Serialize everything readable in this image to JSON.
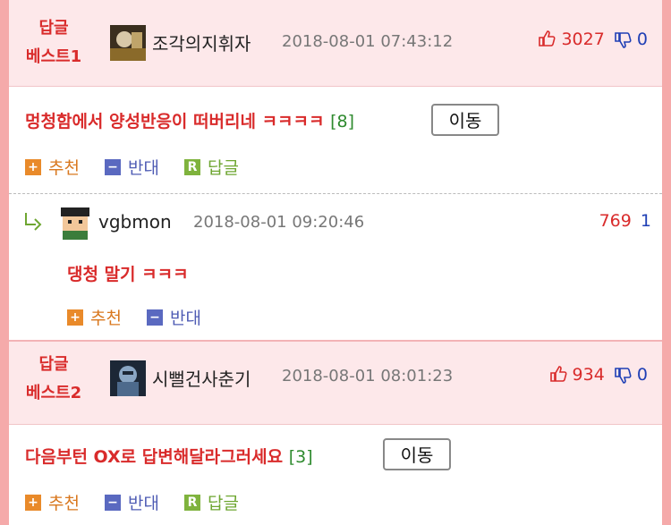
{
  "posts": [
    {
      "label_line1": "답글",
      "label_line2": "베스트1",
      "author": "조각의지휘자",
      "date": "2018-08-01 07:43:12",
      "up": "3027",
      "down": "0",
      "title": "멍청함에서 양성반응이 떠버리네 ㅋㅋㅋㅋ",
      "comment_count": "[8]",
      "move": "이동",
      "actions": {
        "recommend": "추천",
        "oppose": "반대",
        "reply": "답글",
        "reply_badge": "R"
      }
    },
    {
      "label_line1": "답글",
      "label_line2": "베스트2",
      "author": "시뻘건사춘기",
      "date": "2018-08-01 08:01:23",
      "up": "934",
      "down": "0",
      "title": "다음부턴 OX로 답변해달라그러세요",
      "comment_count": "[3]",
      "move": "이동",
      "actions": {
        "recommend": "추천",
        "oppose": "반대",
        "reply": "답글",
        "reply_badge": "R"
      }
    }
  ],
  "reply": {
    "author": "vgbmon",
    "date": "2018-08-01 09:20:46",
    "up": "769",
    "down": "1",
    "text": "댕청 말기 ㅋㅋㅋ",
    "actions": {
      "recommend": "추천",
      "oppose": "반대"
    }
  },
  "colors": {
    "accent": "#d92b2b",
    "blue": "#1f3fb5",
    "best_bg": "#fde8ea",
    "outer_bg": "#f5aaaa"
  },
  "icons": [
    "thumbs-up-icon",
    "thumbs-down-icon",
    "plus-icon",
    "minus-icon",
    "reply-icon",
    "reply-arrow-icon"
  ]
}
